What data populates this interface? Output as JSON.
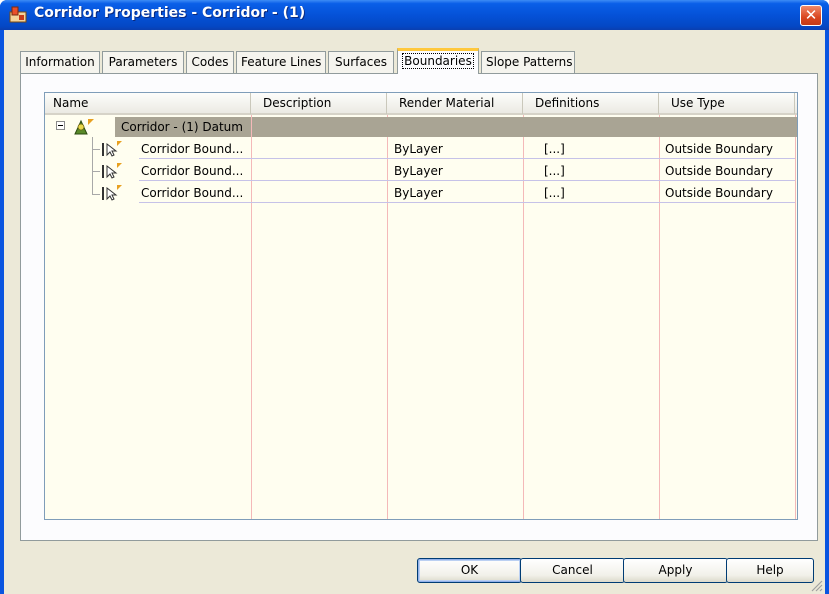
{
  "window": {
    "title": "Corridor Properties - Corridor - (1)",
    "title_icon": "corridor-app-icon",
    "close_glyph": "✕"
  },
  "tabs": [
    {
      "label": "Information"
    },
    {
      "label": "Parameters"
    },
    {
      "label": "Codes"
    },
    {
      "label": "Feature Lines"
    },
    {
      "label": "Surfaces"
    },
    {
      "label": "Boundaries",
      "active": true
    },
    {
      "label": "Slope Patterns"
    }
  ],
  "grid": {
    "columns": [
      "Name",
      "Description",
      "Render Material",
      "Definitions",
      "Use Type"
    ],
    "datum": {
      "name": "Corridor - (1) Datum",
      "icon": "corridor-datum-icon"
    },
    "rows": [
      {
        "name": "Corridor Bound...",
        "description": "",
        "render_material": "ByLayer",
        "definitions": "[...]",
        "use_type": "Outside Boundary",
        "icon": "boundary-pick-icon"
      },
      {
        "name": "Corridor Bound...",
        "description": "",
        "render_material": "ByLayer",
        "definitions": "[...]",
        "use_type": "Outside Boundary",
        "icon": "boundary-pick-icon"
      },
      {
        "name": "Corridor Bound...",
        "description": "",
        "render_material": "ByLayer",
        "definitions": "[...]",
        "use_type": "Outside Boundary",
        "icon": "boundary-pick-icon"
      }
    ]
  },
  "buttons": {
    "ok": "OK",
    "cancel": "Cancel",
    "apply": "Apply",
    "help": "Help"
  },
  "colors": {
    "title_bar": "#0552d8",
    "dialog_face": "#ece9d8",
    "grid_background": "#fffef0",
    "datum_row": "#a9a494",
    "column_lines": "#f4b9b9",
    "active_tab_accent": "#ffc83c"
  }
}
